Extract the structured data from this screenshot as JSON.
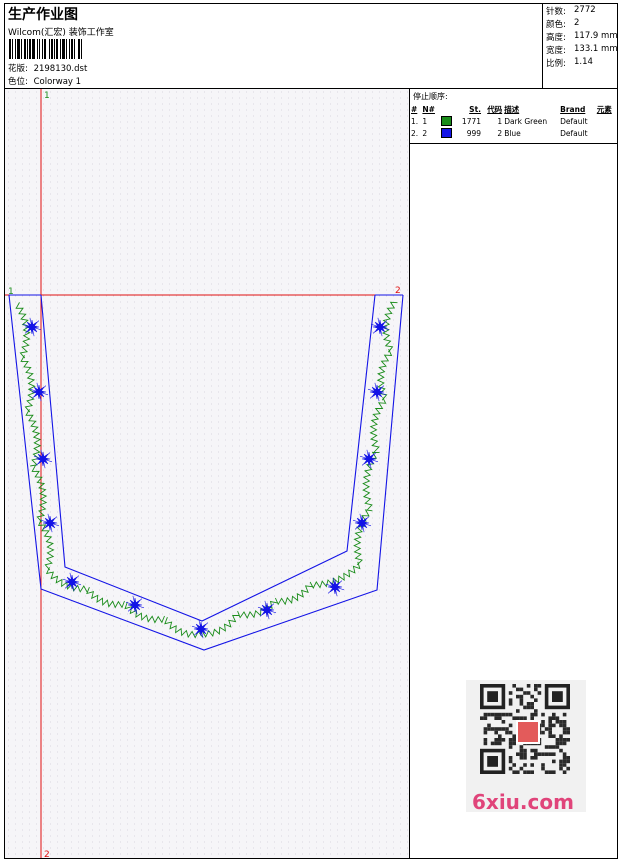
{
  "header": {
    "title": "生产作业图",
    "studio": "Wilcom(汇宏) 装饰工作室",
    "design_label": "花版:",
    "design_value": "2198130.dst",
    "colorway_label": "色位:",
    "colorway_value": "Colorway 1"
  },
  "stats": [
    {
      "label": "针数:",
      "value": "2772"
    },
    {
      "label": "颜色:",
      "value": "2"
    },
    {
      "label": "高度:",
      "value": "117.9 mm"
    },
    {
      "label": "宽度:",
      "value": "133.1 mm"
    },
    {
      "label": "比例:",
      "value": "1.14"
    }
  ],
  "stop_sequence": {
    "title": "停止顺序:",
    "headers": [
      "#",
      "N#",
      "St.",
      "代码",
      "描述",
      "Brand",
      "元素"
    ],
    "rows": [
      {
        "index": "1.",
        "n": "1",
        "color": "#1a8c1a",
        "stitches": "1771",
        "code": "1",
        "description": "Dark Green",
        "brand": "Default"
      },
      {
        "index": "2.",
        "n": "2",
        "color": "#1414e6",
        "stitches": "999",
        "code": "2",
        "description": "Blue",
        "brand": "Default"
      }
    ]
  },
  "canvas": {
    "marker_1": "1",
    "marker_2": "2",
    "marker_1_left": "1",
    "marker_2_right": "2",
    "marker_2_bottom": "2",
    "guide_color": "#e01010",
    "outline_color": "#1414e6",
    "zigzag_color": "#1a8c1a"
  },
  "watermark": {
    "text": "6xiu.com",
    "seal_text": "锐图网"
  }
}
